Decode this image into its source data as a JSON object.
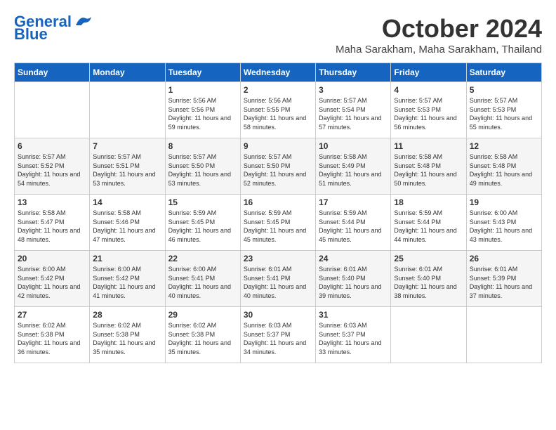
{
  "header": {
    "logo_line1": "General",
    "logo_line2": "Blue",
    "month": "October 2024",
    "location": "Maha Sarakham, Maha Sarakham, Thailand"
  },
  "weekdays": [
    "Sunday",
    "Monday",
    "Tuesday",
    "Wednesday",
    "Thursday",
    "Friday",
    "Saturday"
  ],
  "weeks": [
    [
      {
        "day": "",
        "info": ""
      },
      {
        "day": "",
        "info": ""
      },
      {
        "day": "1",
        "info": "Sunrise: 5:56 AM\nSunset: 5:56 PM\nDaylight: 11 hours and 59 minutes."
      },
      {
        "day": "2",
        "info": "Sunrise: 5:56 AM\nSunset: 5:55 PM\nDaylight: 11 hours and 58 minutes."
      },
      {
        "day": "3",
        "info": "Sunrise: 5:57 AM\nSunset: 5:54 PM\nDaylight: 11 hours and 57 minutes."
      },
      {
        "day": "4",
        "info": "Sunrise: 5:57 AM\nSunset: 5:53 PM\nDaylight: 11 hours and 56 minutes."
      },
      {
        "day": "5",
        "info": "Sunrise: 5:57 AM\nSunset: 5:53 PM\nDaylight: 11 hours and 55 minutes."
      }
    ],
    [
      {
        "day": "6",
        "info": "Sunrise: 5:57 AM\nSunset: 5:52 PM\nDaylight: 11 hours and 54 minutes."
      },
      {
        "day": "7",
        "info": "Sunrise: 5:57 AM\nSunset: 5:51 PM\nDaylight: 11 hours and 53 minutes."
      },
      {
        "day": "8",
        "info": "Sunrise: 5:57 AM\nSunset: 5:50 PM\nDaylight: 11 hours and 53 minutes."
      },
      {
        "day": "9",
        "info": "Sunrise: 5:57 AM\nSunset: 5:50 PM\nDaylight: 11 hours and 52 minutes."
      },
      {
        "day": "10",
        "info": "Sunrise: 5:58 AM\nSunset: 5:49 PM\nDaylight: 11 hours and 51 minutes."
      },
      {
        "day": "11",
        "info": "Sunrise: 5:58 AM\nSunset: 5:48 PM\nDaylight: 11 hours and 50 minutes."
      },
      {
        "day": "12",
        "info": "Sunrise: 5:58 AM\nSunset: 5:48 PM\nDaylight: 11 hours and 49 minutes."
      }
    ],
    [
      {
        "day": "13",
        "info": "Sunrise: 5:58 AM\nSunset: 5:47 PM\nDaylight: 11 hours and 48 minutes."
      },
      {
        "day": "14",
        "info": "Sunrise: 5:58 AM\nSunset: 5:46 PM\nDaylight: 11 hours and 47 minutes."
      },
      {
        "day": "15",
        "info": "Sunrise: 5:59 AM\nSunset: 5:45 PM\nDaylight: 11 hours and 46 minutes."
      },
      {
        "day": "16",
        "info": "Sunrise: 5:59 AM\nSunset: 5:45 PM\nDaylight: 11 hours and 45 minutes."
      },
      {
        "day": "17",
        "info": "Sunrise: 5:59 AM\nSunset: 5:44 PM\nDaylight: 11 hours and 45 minutes."
      },
      {
        "day": "18",
        "info": "Sunrise: 5:59 AM\nSunset: 5:44 PM\nDaylight: 11 hours and 44 minutes."
      },
      {
        "day": "19",
        "info": "Sunrise: 6:00 AM\nSunset: 5:43 PM\nDaylight: 11 hours and 43 minutes."
      }
    ],
    [
      {
        "day": "20",
        "info": "Sunrise: 6:00 AM\nSunset: 5:42 PM\nDaylight: 11 hours and 42 minutes."
      },
      {
        "day": "21",
        "info": "Sunrise: 6:00 AM\nSunset: 5:42 PM\nDaylight: 11 hours and 41 minutes."
      },
      {
        "day": "22",
        "info": "Sunrise: 6:00 AM\nSunset: 5:41 PM\nDaylight: 11 hours and 40 minutes."
      },
      {
        "day": "23",
        "info": "Sunrise: 6:01 AM\nSunset: 5:41 PM\nDaylight: 11 hours and 40 minutes."
      },
      {
        "day": "24",
        "info": "Sunrise: 6:01 AM\nSunset: 5:40 PM\nDaylight: 11 hours and 39 minutes."
      },
      {
        "day": "25",
        "info": "Sunrise: 6:01 AM\nSunset: 5:40 PM\nDaylight: 11 hours and 38 minutes."
      },
      {
        "day": "26",
        "info": "Sunrise: 6:01 AM\nSunset: 5:39 PM\nDaylight: 11 hours and 37 minutes."
      }
    ],
    [
      {
        "day": "27",
        "info": "Sunrise: 6:02 AM\nSunset: 5:38 PM\nDaylight: 11 hours and 36 minutes."
      },
      {
        "day": "28",
        "info": "Sunrise: 6:02 AM\nSunset: 5:38 PM\nDaylight: 11 hours and 35 minutes."
      },
      {
        "day": "29",
        "info": "Sunrise: 6:02 AM\nSunset: 5:38 PM\nDaylight: 11 hours and 35 minutes."
      },
      {
        "day": "30",
        "info": "Sunrise: 6:03 AM\nSunset: 5:37 PM\nDaylight: 11 hours and 34 minutes."
      },
      {
        "day": "31",
        "info": "Sunrise: 6:03 AM\nSunset: 5:37 PM\nDaylight: 11 hours and 33 minutes."
      },
      {
        "day": "",
        "info": ""
      },
      {
        "day": "",
        "info": ""
      }
    ]
  ]
}
